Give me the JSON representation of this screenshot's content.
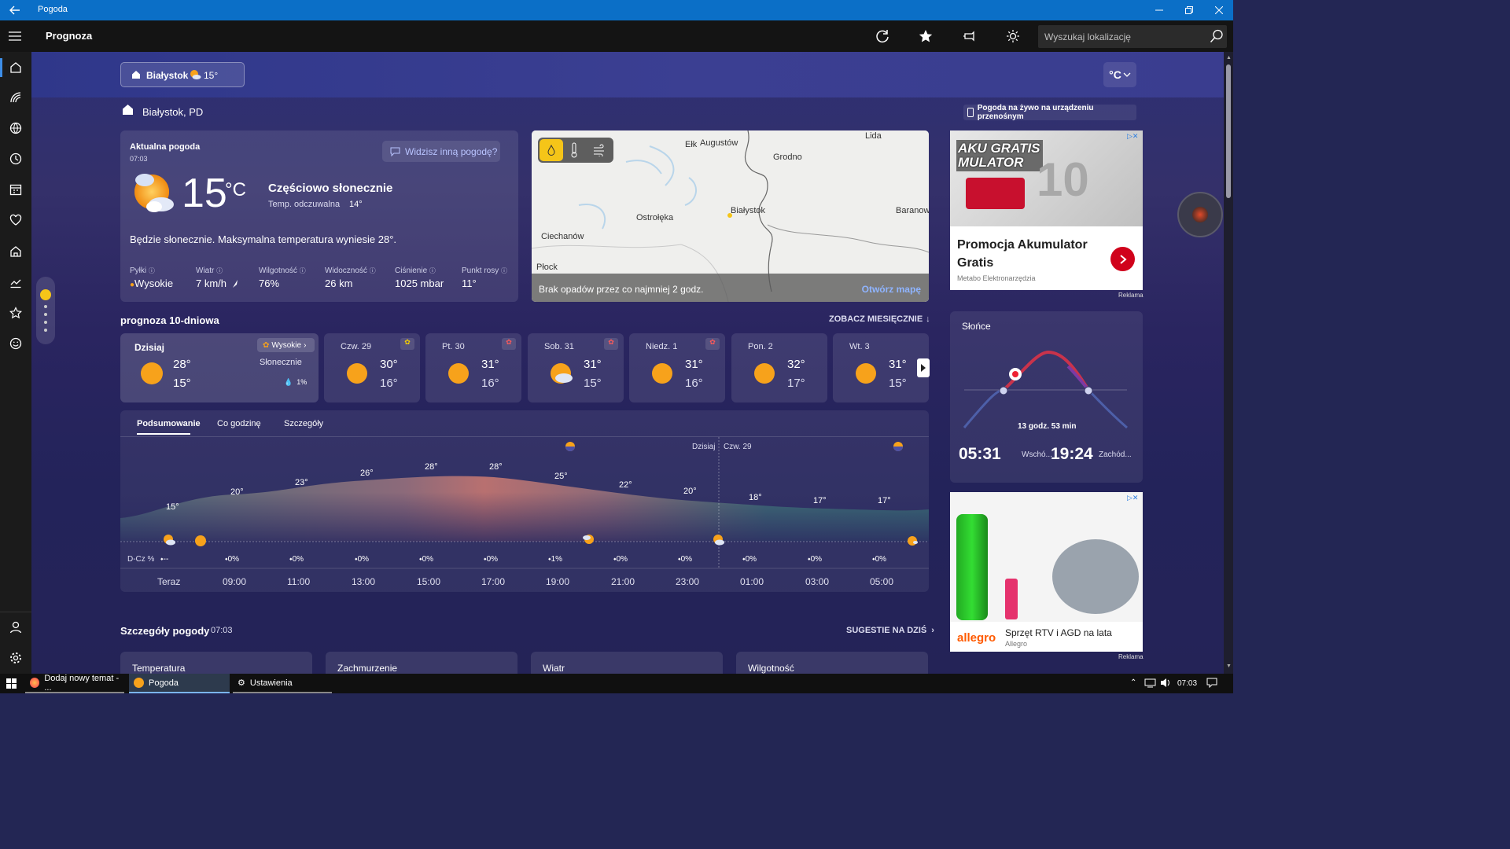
{
  "window": {
    "title": "Pogoda"
  },
  "header": {
    "title": "Prognoza",
    "search_placeholder": "Wyszukaj lokalizację"
  },
  "location_chip": {
    "name": "Białystok",
    "temp": "15°"
  },
  "unit": "°C",
  "location": {
    "title": "Białystok, PD",
    "live_link": "Pogoda na żywo na urządzeniu przenośnym"
  },
  "current": {
    "heading": "Aktualna pogoda",
    "time": "07:03",
    "feedback_button": "Widzisz inną pogodę?",
    "temp": "15",
    "unit": "°C",
    "condition": "Częściowo słonecznie",
    "feels_label": "Temp. odczuwalna",
    "feels_value": "14°",
    "summary": "Będzie słonecznie. Maksymalna temperatura wyniesie 28°.",
    "stats": [
      {
        "label": "Pyłki",
        "value": "Wysokie"
      },
      {
        "label": "Wiatr",
        "value": "7 km/h"
      },
      {
        "label": "Wilgotność",
        "value": "76%"
      },
      {
        "label": "Widoczność",
        "value": "26 km"
      },
      {
        "label": "Ciśnienie",
        "value": "1025 mbar"
      },
      {
        "label": "Punkt rosy",
        "value": "11°"
      }
    ]
  },
  "map": {
    "labels": [
      "Ełk",
      "Augustów",
      "Lida",
      "Grodno",
      "Ostrołęka",
      "Białystok",
      "Baranow",
      "Ciechanów",
      "Płock"
    ],
    "footer_text": "Brak opadów przez co najmniej 2 godz.",
    "open_map": "Otwórz mapę"
  },
  "forecast": {
    "title": "prognoza 10-dniowa",
    "monthly_link": "ZOBACZ MIESIĘCZNIE",
    "today": {
      "label": "Dzisiaj",
      "pollen": "Wysokie",
      "high": "28°",
      "low": "15°",
      "condition": "Słonecznie",
      "precip": "1%"
    },
    "days": [
      {
        "label": "Czw. 29",
        "high": "30°",
        "low": "16°"
      },
      {
        "label": "Pt. 30",
        "high": "31°",
        "low": "16°"
      },
      {
        "label": "Sob. 31",
        "high": "31°",
        "low": "15°"
      },
      {
        "label": "Niedz. 1",
        "high": "31°",
        "low": "16°"
      },
      {
        "label": "Pon. 2",
        "high": "32°",
        "low": "17°"
      },
      {
        "label": "Wt. 3",
        "high": "31°",
        "low": "15°"
      }
    ]
  },
  "hourly": {
    "tabs": [
      "Podsumowanie",
      "Co godzinę",
      "Szczegóły"
    ],
    "today_label": "Dzisiaj",
    "next_label": "Czw. 29",
    "precip_label": "D-Cz %",
    "temps": [
      "15°",
      "20°",
      "23°",
      "26°",
      "28°",
      "28°",
      "25°",
      "22°",
      "20°",
      "18°",
      "17°",
      "17°"
    ],
    "precip": [
      "--",
      "0%",
      "0%",
      "0%",
      "0%",
      "0%",
      "1%",
      "0%",
      "0%",
      "0%",
      "0%",
      "0%"
    ],
    "times": [
      "Teraz",
      "09:00",
      "11:00",
      "13:00",
      "15:00",
      "17:00",
      "19:00",
      "21:00",
      "23:00",
      "01:00",
      "03:00",
      "05:00"
    ]
  },
  "sun": {
    "title": "Słońce",
    "duration": "13 godz. 53 min",
    "sunrise": "05:31",
    "sunrise_label": "Wschó...",
    "sunset": "19:24",
    "sunset_label": "Zachód..."
  },
  "ad1": {
    "headline": "Promocja Akumulator Gratis",
    "advertiser": "Metabo Elektronarzędzia",
    "badge": "Reklama",
    "image_text": "AKU GRATIS MULATOR"
  },
  "ad2": {
    "headline": "Sprzęt RTV i AGD na lata",
    "advertiser": "Allegro",
    "brand": "allegro",
    "badge": "Reklama"
  },
  "details": {
    "title": "Szczegóły pogody",
    "time": "07:03",
    "suggest_link": "SUGESTIE NA DZIŚ",
    "cards": [
      "Temperatura",
      "Zachmurzenie",
      "Wiatr",
      "Wilgotność"
    ]
  },
  "taskbar": {
    "items": [
      "Dodaj nowy temat - ...",
      "Pogoda",
      "Ustawienia"
    ],
    "clock": "07:03"
  },
  "colors": {
    "titlebar": "#0b6fc7",
    "accent_sun": "#f7a21b",
    "ad_red": "#d0021b"
  }
}
